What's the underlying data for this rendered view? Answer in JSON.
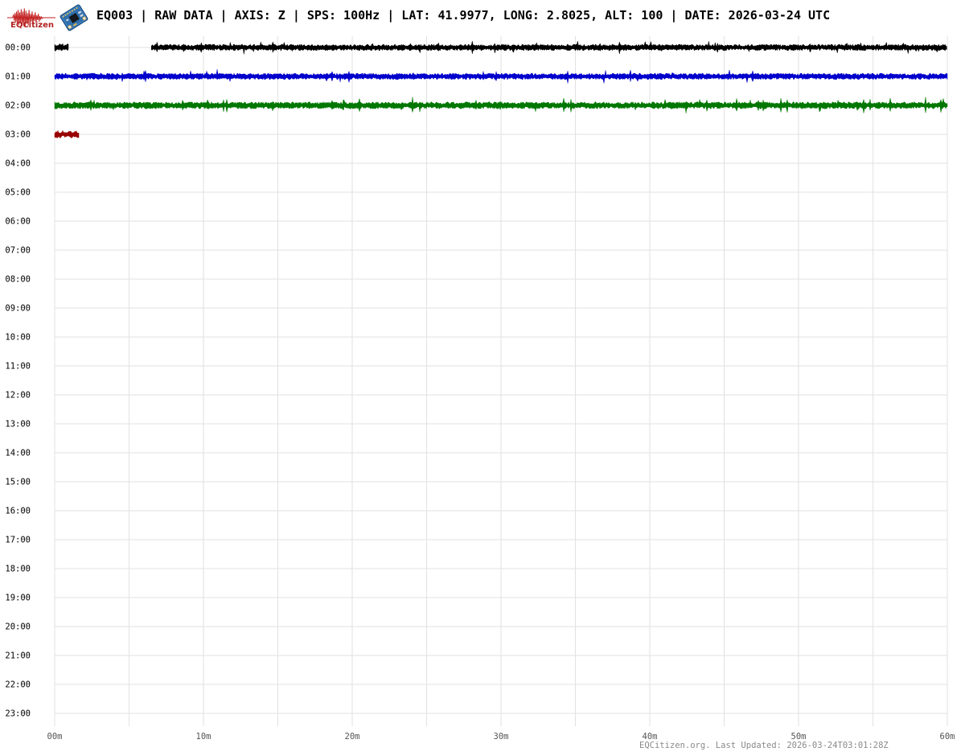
{
  "header": {
    "logo_text": "EQCitizen",
    "title": "EQ003 | RAW DATA | AXIS: Z | SPS: 100Hz | LAT: 41.9977, LONG: 2.8025, ALT: 100 | DATE: 2026-03-24 UTC"
  },
  "footer": {
    "text": "EQCitizen.org. Last Updated: 2026-03-24T03:01:28Z"
  },
  "chart_data": {
    "type": "line",
    "subtype": "helicorder-seismogram",
    "station": "EQ003",
    "data_kind": "RAW DATA",
    "axis": "Z",
    "sps": "100Hz",
    "lat": "41.9977",
    "long": "2.8025",
    "alt": "100",
    "date_utc": "2026-03-24",
    "grid": true,
    "x_axis": {
      "tick_labels": [
        "00m",
        "10m",
        "20m",
        "30m",
        "40m",
        "50m",
        "60m"
      ],
      "range_minutes": [
        0,
        60
      ],
      "minor_grid_interval_minutes": 5
    },
    "y_axis": {
      "rows": [
        "00:00",
        "01:00",
        "02:00",
        "03:00",
        "04:00",
        "05:00",
        "06:00",
        "07:00",
        "08:00",
        "09:00",
        "10:00",
        "11:00",
        "12:00",
        "13:00",
        "14:00",
        "15:00",
        "16:00",
        "17:00",
        "18:00",
        "19:00",
        "20:00",
        "21:00",
        "22:00",
        "23:00"
      ]
    },
    "colors": {
      "grid": "#e2e2e2",
      "y_label": "#000000",
      "x_label": "#555555",
      "footer": "#8a8a8a"
    },
    "traces": [
      {
        "row_label": "00:00",
        "row_index": 0,
        "color": "#000000",
        "segments": [
          {
            "start_min": 0.0,
            "end_min": 0.95,
            "amplitude": 1.25
          },
          {
            "start_min": 6.5,
            "end_min": 60.0,
            "amplitude": 1.0
          }
        ]
      },
      {
        "row_label": "01:00",
        "row_index": 1,
        "color": "#0000cc",
        "segments": [
          {
            "start_min": 0.0,
            "end_min": 60.0,
            "amplitude": 1.0
          }
        ]
      },
      {
        "row_label": "02:00",
        "row_index": 2,
        "color": "#007700",
        "segments": [
          {
            "start_min": 0.0,
            "end_min": 60.0,
            "amplitude": 1.1
          }
        ]
      },
      {
        "row_label": "03:00",
        "row_index": 3,
        "color": "#990000",
        "segments": [
          {
            "start_min": 0.0,
            "end_min": 1.65,
            "amplitude": 1.2
          }
        ]
      }
    ]
  }
}
